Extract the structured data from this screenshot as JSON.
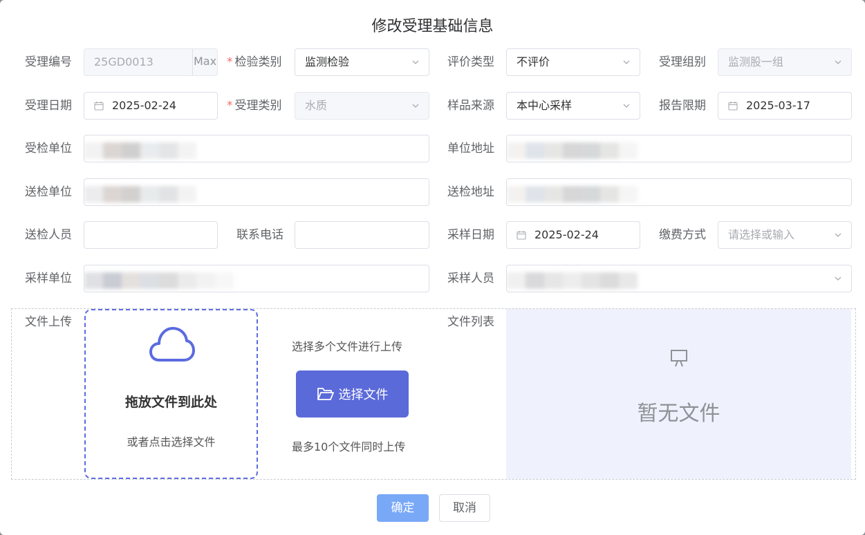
{
  "dialog": {
    "title": "修改受理基础信息"
  },
  "fields": {
    "acceptance_no": {
      "label": "受理编号",
      "value": "25GD0013",
      "append": "Max"
    },
    "inspection_category": {
      "label": "检验类别",
      "value": "监测检验"
    },
    "evaluation_type": {
      "label": "评价类型",
      "value": "不评价"
    },
    "acceptance_group": {
      "label": "受理组别",
      "value": "监测股一组"
    },
    "acceptance_date": {
      "label": "受理日期",
      "value": "2025-02-24"
    },
    "acceptance_category": {
      "label": "受理类别",
      "value": "水质"
    },
    "sample_source": {
      "label": "样品来源",
      "value": "本中心采样"
    },
    "report_deadline": {
      "label": "报告限期",
      "value": "2025-03-17"
    },
    "inspected_unit": {
      "label": "受检单位"
    },
    "unit_address": {
      "label": "单位地址"
    },
    "submitting_unit": {
      "label": "送检单位"
    },
    "submitting_address": {
      "label": "送检地址"
    },
    "submitter": {
      "label": "送检人员",
      "value": ""
    },
    "phone": {
      "label": "联系电话",
      "value": ""
    },
    "sampling_date": {
      "label": "采样日期",
      "value": "2025-02-24"
    },
    "payment_method": {
      "label": "缴费方式",
      "placeholder": "请选择或输入"
    },
    "sampling_unit": {
      "label": "采样单位"
    },
    "sampler": {
      "label": "采样人员"
    }
  },
  "upload": {
    "label": "文件上传",
    "drop_title": "拖放文件到此处",
    "drop_sub": "或者点击选择文件",
    "multi_hint": "选择多个文件进行上传",
    "choose_button": "选择文件",
    "max_hint": "最多10个文件同时上传"
  },
  "file_list": {
    "label": "文件列表",
    "empty_text": "暂无文件"
  },
  "footer": {
    "ok_label": "确定",
    "cancel_label": "取消"
  },
  "colors": {
    "primary": "#5b6ad9",
    "ok_button": "#79a8f7",
    "required": "#f56c6c",
    "file_list_bg": "#eff2fc"
  }
}
